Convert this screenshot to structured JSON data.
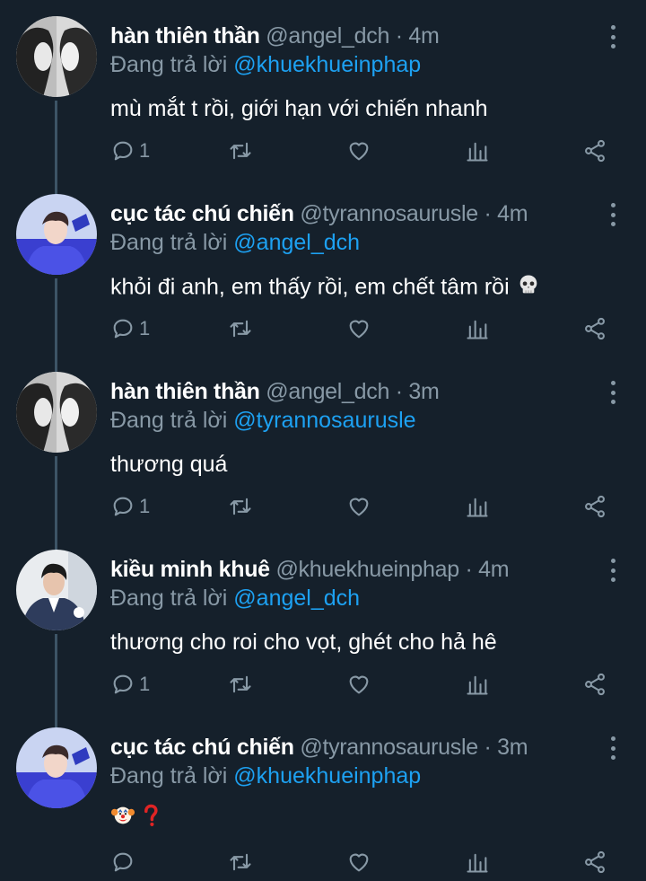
{
  "reply_prefix": "Đang trả lời",
  "tweets": [
    {
      "name": "hàn thiên thần",
      "handle": "@angel_dch",
      "time": "4m",
      "reply_to": "@khuekhueinphap",
      "text": "mù mắt t rồi, giới hạn với chiến nhanh",
      "reply_count": "1",
      "avatar": "bw-twins-avatar"
    },
    {
      "name": "cục tác chú chiến",
      "handle": "@tyrannosaurusle",
      "time": "4m",
      "reply_to": "@angel_dch",
      "text": "khỏi đi anh, em thấy rồi, em chết tâm rồi",
      "trailing_emoji": "skull-emoji",
      "reply_count": "1",
      "avatar": "purple-portrait-avatar"
    },
    {
      "name": "hàn thiên thần",
      "handle": "@angel_dch",
      "time": "3m",
      "reply_to": "@tyrannosaurusle",
      "text": "thương quá",
      "reply_count": "1",
      "avatar": "bw-twins-avatar"
    },
    {
      "name": "kiều minh khuê",
      "handle": "@khuekhueinphap",
      "time": "4m",
      "reply_to": "@angel_dch",
      "text": "thương cho roi cho vọt, ghét cho hả hê",
      "reply_count": "1",
      "avatar": "suit-portrait-avatar"
    },
    {
      "name": "cục tác chú chiến",
      "handle": "@tyrannosaurusle",
      "time": "3m",
      "reply_to": "@khuekhueinphap",
      "text": "",
      "emojis": [
        "clown-emoji",
        "question-mark-emoji"
      ],
      "reply_count": "",
      "avatar": "purple-portrait-avatar"
    }
  ],
  "colors": {
    "background": "#15202b",
    "muted": "#8899a6",
    "mention": "#1da1f2",
    "thread_line": "#3d5466"
  }
}
